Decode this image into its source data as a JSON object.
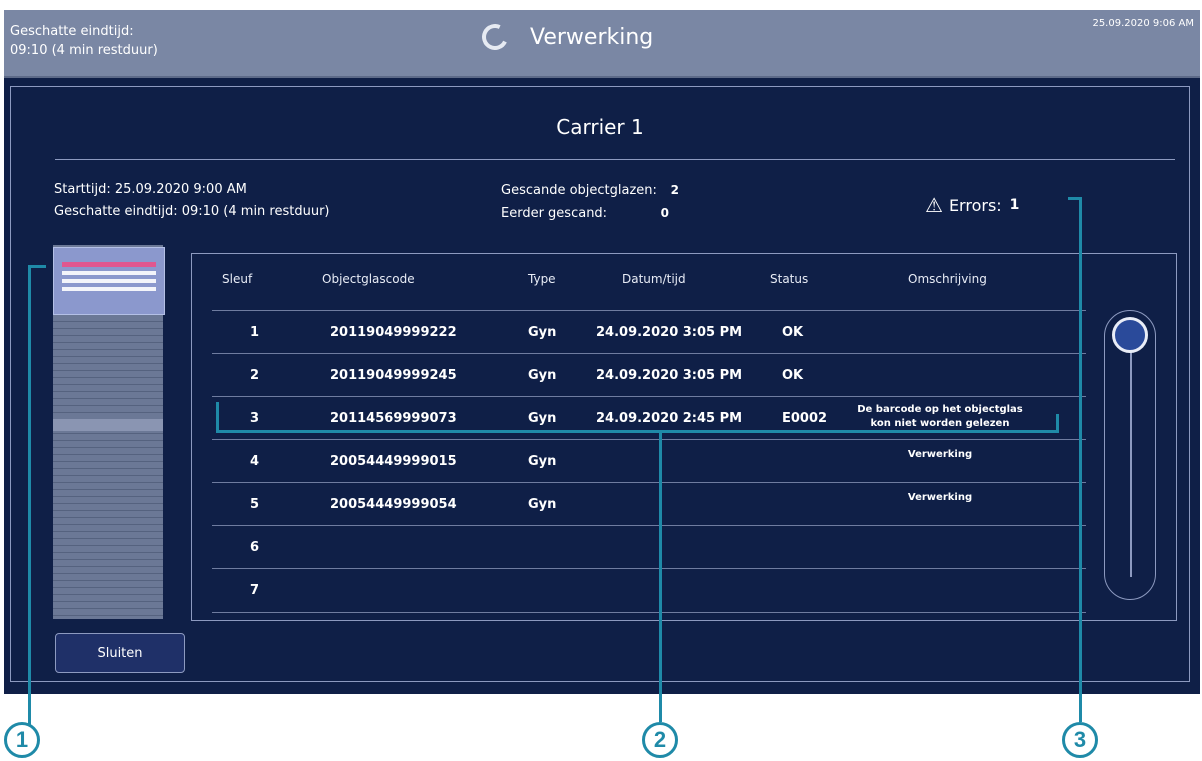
{
  "topbar": {
    "est_label": "Geschatte eindtijd:",
    "est_value": "09:10 (4 min restduur)",
    "title": "Verwerking",
    "datetime": "25.09.2020 9:06 AM"
  },
  "panel": {
    "title": "Carrier 1",
    "start_line": "Starttijd:  25.09.2020 9:00 AM",
    "end_line": "Geschatte eindtijd:  09:10 (4 min restduur)",
    "scanned_label": "Gescande objectglazen:",
    "scanned_value": "2",
    "previous_label": "Eerder gescand:",
    "previous_value": "0",
    "errors_label": "Errors:",
    "errors_value": "1",
    "close_label": "Sluiten"
  },
  "table": {
    "headers": [
      "Sleuf",
      "Objectglascode",
      "Type",
      "Datum/tijd",
      "Status",
      "Omschrijving"
    ],
    "rows": [
      {
        "slot": "1",
        "code": "20119049999222",
        "type": "Gyn",
        "datetime": "24.09.2020 3:05 PM",
        "status": "OK",
        "desc1": "",
        "desc2": ""
      },
      {
        "slot": "2",
        "code": "20119049999245",
        "type": "Gyn",
        "datetime": "24.09.2020 3:05 PM",
        "status": "OK",
        "desc1": "",
        "desc2": ""
      },
      {
        "slot": "3",
        "code": "20114569999073",
        "type": "Gyn",
        "datetime": "24.09.2020 2:45 PM",
        "status": "E0002",
        "desc1": "De barcode op het objectglas",
        "desc2": "kon niet worden gelezen"
      },
      {
        "slot": "4",
        "code": "20054449999015",
        "type": "Gyn",
        "datetime": "",
        "status": "",
        "desc1": "Verwerking",
        "desc2": ""
      },
      {
        "slot": "5",
        "code": "20054449999054",
        "type": "Gyn",
        "datetime": "",
        "status": "",
        "desc1": "Verwerking",
        "desc2": ""
      },
      {
        "slot": "6",
        "code": "",
        "type": "",
        "datetime": "",
        "status": "",
        "desc1": "",
        "desc2": ""
      },
      {
        "slot": "7",
        "code": "",
        "type": "",
        "datetime": "",
        "status": "",
        "desc1": "",
        "desc2": ""
      }
    ]
  },
  "callouts": [
    "1",
    "2",
    "3"
  ],
  "icons": {
    "spinner": "loading-spinner-icon",
    "warning": "warning-triangle-icon"
  },
  "colors": {
    "background": "#0f1f47",
    "topbar": "#7a87a4",
    "highlight": "#e0578f",
    "callout": "#1f8aa8"
  }
}
